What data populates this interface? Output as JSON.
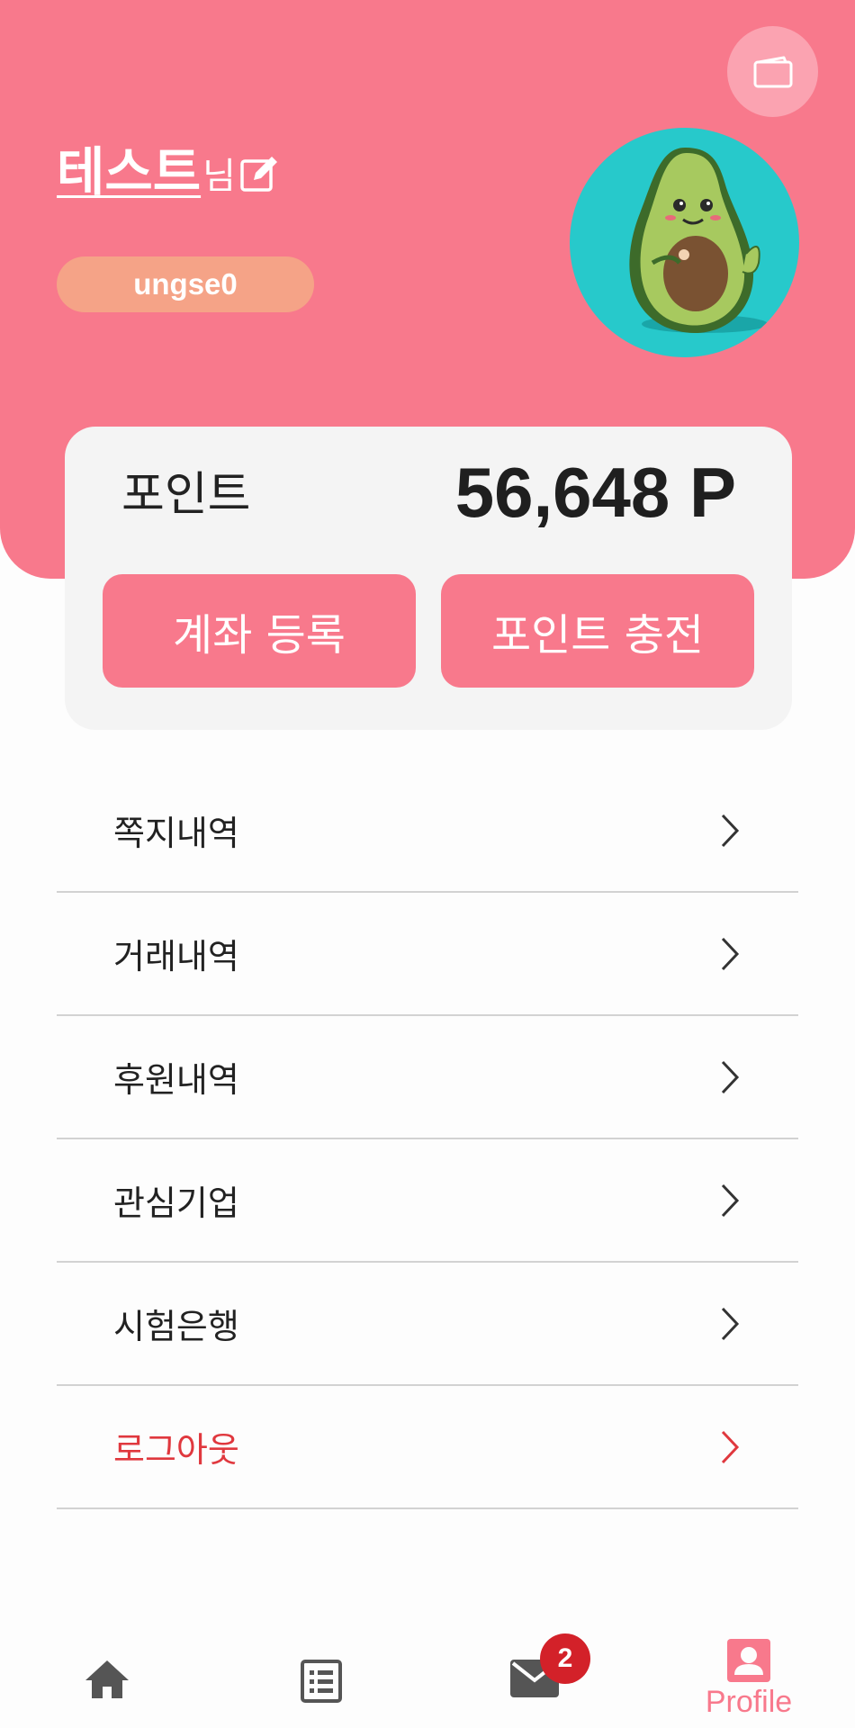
{
  "header": {
    "username": "테스트",
    "honorific": "님",
    "user_id": "ungse0",
    "icons": [
      "wallet-icon",
      "edit-icon"
    ],
    "avatar": "avocado-avatar",
    "color": "#f8798c"
  },
  "points": {
    "label": "포인트",
    "value": "56,648 P",
    "register_account_label": "계좌 등록",
    "charge_label": "포인트 충전"
  },
  "menu": {
    "items": [
      {
        "label": "쪽지내역"
      },
      {
        "label": "거래내역"
      },
      {
        "label": "후원내역"
      },
      {
        "label": "관심기업"
      },
      {
        "label": "시험은행"
      },
      {
        "label": "로그아웃",
        "color": "#e0383e"
      }
    ],
    "chevron_icon": "chevron-right-icon"
  },
  "tabbar": {
    "tabs": [
      {
        "icon": "home-icon"
      },
      {
        "icon": "list-icon"
      },
      {
        "icon": "mail-icon",
        "badge": "2"
      },
      {
        "icon": "profile-icon",
        "label": "Profile",
        "active": true
      }
    ]
  }
}
